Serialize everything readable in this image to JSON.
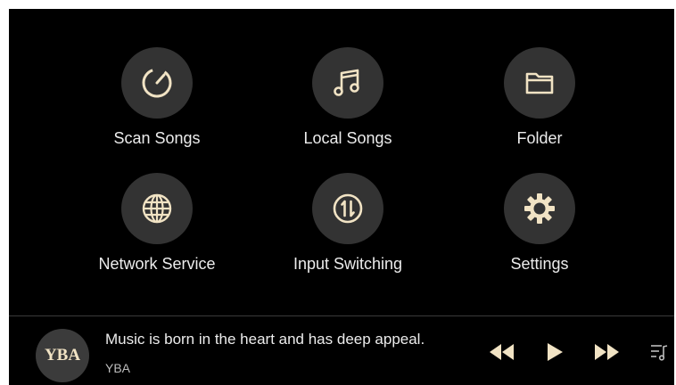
{
  "accent_color": "#f1e3c4",
  "background_color": "#000000",
  "tile_background": "#333333",
  "menu": [
    {
      "id": "scan-songs",
      "label": "Scan Songs",
      "icon": "gauge-icon"
    },
    {
      "id": "local-songs",
      "label": "Local Songs",
      "icon": "music-note-icon"
    },
    {
      "id": "folder",
      "label": "Folder",
      "icon": "folder-icon"
    },
    {
      "id": "network-service",
      "label": "Network Service",
      "icon": "globe-icon"
    },
    {
      "id": "input-switching",
      "label": "Input Switching",
      "icon": "input-switch-icon"
    },
    {
      "id": "settings",
      "label": "Settings",
      "icon": "gear-icon"
    }
  ],
  "now_playing": {
    "album_art_text": "YBA",
    "title": "Music is born in the heart and has deep appeal.",
    "artist": "YBA"
  },
  "controls": {
    "previous_icon": "rewind-icon",
    "play_icon": "play-icon",
    "next_icon": "fast-forward-icon",
    "playlist_icon": "playlist-icon"
  }
}
